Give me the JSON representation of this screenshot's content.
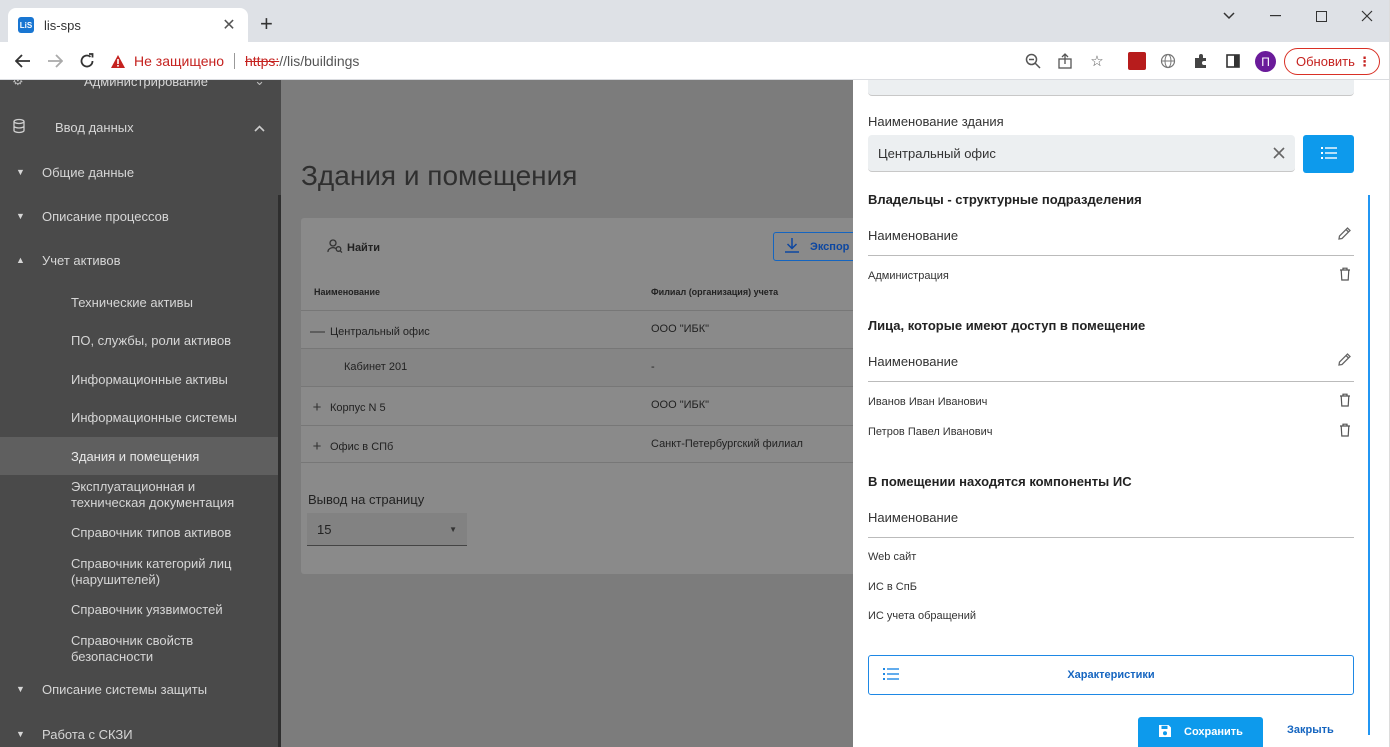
{
  "browser": {
    "tab_title": "lis-sps",
    "favicon_text": "LiS",
    "not_secure": "Не защищено",
    "url_proto": "https:",
    "url_rest": "//lis/buildings",
    "update_label": "Обновить",
    "avatar_letter": "П"
  },
  "sidebar": {
    "items": [
      {
        "label": "Администрирование"
      },
      {
        "label": "Ввод данных"
      },
      {
        "label": "Общие данные"
      },
      {
        "label": "Описание процессов"
      },
      {
        "label": "Учет активов"
      },
      {
        "label": "Технические активы"
      },
      {
        "label": "ПО, службы, роли активов"
      },
      {
        "label": "Информационные активы"
      },
      {
        "label": "Информационные системы"
      },
      {
        "label": "Здания и помещения"
      },
      {
        "label": "Эксплуатационная и техническая документация"
      },
      {
        "label": "Справочник типов активов"
      },
      {
        "label": "Справочник категорий лиц (нарушителей)"
      },
      {
        "label": "Справочник уязвимостей"
      },
      {
        "label": "Справочник свойств безопасности"
      },
      {
        "label": "Описание системы защиты"
      },
      {
        "label": "Работа с СКЗИ"
      }
    ]
  },
  "main": {
    "title": "Здания и помещения",
    "find_label": "Найти",
    "export_label": "Экспор",
    "columns": [
      "Наименование",
      "Филиал (организация) учета"
    ],
    "rows": [
      {
        "sign": "—",
        "name": "Центральный офис",
        "branch": "ООО \"ИБК\""
      },
      {
        "sign": "",
        "name": "Кабинет 201",
        "branch": "-"
      },
      {
        "sign": "+",
        "name": "Корпус N 5",
        "branch": "ООО \"ИБК\""
      },
      {
        "sign": "+",
        "name": "Офис в СПб",
        "branch": "Санкт-Петербургский филиал"
      }
    ],
    "per_page_label": "Вывод на страницу",
    "per_page_value": "15"
  },
  "panel": {
    "building_name_label": "Наименование здания",
    "building_name_value": "Центральный офис",
    "owners_title": "Владельцы - структурные подразделения",
    "owners_col": "Наименование",
    "owners": [
      "Администрация"
    ],
    "access_title": "Лица, которые имеют доступ в помещение",
    "access_col": "Наименование",
    "access": [
      "Иванов Иван Иванович",
      "Петров Павел Иванович"
    ],
    "components_title": "В помещении находятся компоненты ИС",
    "components_col": "Наименование",
    "components": [
      "Web сайт",
      "ИС в СпБ",
      "ИС учета обращений"
    ],
    "characteristics_label": "Характеристики",
    "save_label": "Сохранить",
    "close_label": "Закрыть"
  },
  "colors": {
    "accent": "#0d9aec",
    "sidebar_bg": "#4a4a4a",
    "overlay_bg": "#7c7c7c",
    "danger": "#c5221f"
  }
}
